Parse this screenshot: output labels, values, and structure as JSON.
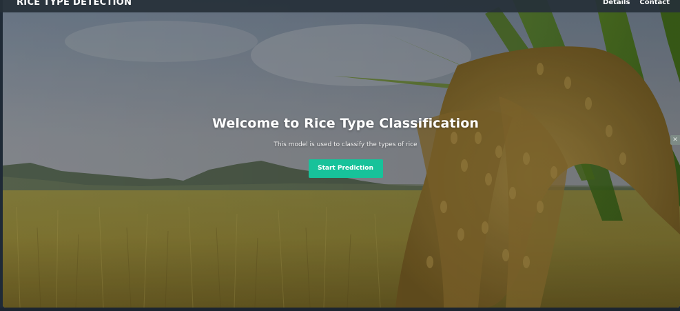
{
  "navbar": {
    "brand": "RICE TYPE DETECTION",
    "links": [
      "Details",
      "Contact"
    ]
  },
  "hero": {
    "title": "Welcome to Rice Type Classification",
    "subtitle": "This model is used to classify the types of rice",
    "cta_label": "Start Prediction",
    "side_icon": "close-icon"
  },
  "colors": {
    "accent": "#17c29a",
    "navbar_bg": "#263038",
    "sky": "#9aa2ad",
    "field": "#a89a4a"
  }
}
